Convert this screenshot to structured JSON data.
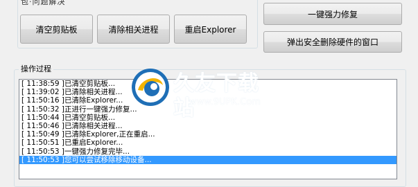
{
  "top_label": "包·问题解决",
  "buttons": {
    "clear_clipboard": "清空剪贴板",
    "kill_processes": "清除相关进程",
    "restart_explorer": "重启Explorer",
    "one_click_repair": "一键强力修复",
    "eject_window": "弹出安全删除硬件的窗口"
  },
  "log_group": {
    "title": "操作过程",
    "lines": [
      "[ 11:38:59 ]已清空剪贴板...",
      "[ 11:39:02 ]已清除相关进程...",
      "[ 11:50:16 ]已清除Explorer...",
      "[ 11:50:32 ]正进行一键强力修复...",
      "[ 11:50:44 ]已清空剪贴板...",
      "[ 11:50:46 ]已清除相关进程...",
      "[ 11:50:49 ]已清除Explorer,正在重启...",
      "[ 11:50:51 ]已重启Explorer...",
      "[ 11:50:53 ]一键强力修复完毕...",
      "[ 11:50:53 ]您可以尝试移除移动设备..."
    ],
    "selected_index": 9
  },
  "watermark": {
    "title": "久友下载站",
    "url": "www.9UPK.Com"
  }
}
